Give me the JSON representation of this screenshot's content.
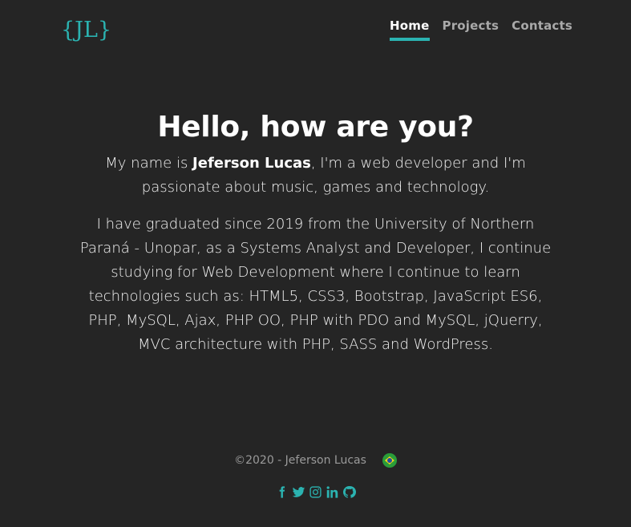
{
  "header": {
    "logo": "{JL}",
    "nav": [
      {
        "label": "Home",
        "active": true
      },
      {
        "label": "Projects",
        "active": false
      },
      {
        "label": "Contacts",
        "active": false
      }
    ]
  },
  "hero": {
    "title": "Hello, how are you?",
    "intro_before": "My name is ",
    "name": "Jeferson Lucas",
    "intro_after": ", I'm a web developer and I'm passionate about music, games and technology.",
    "about": "I have graduated since 2019 from the University of Northern Paraná - Unopar, as a Systems Analyst and Developer, I continue studying for Web Development where I continue to learn technologies such as: HTML5, CSS3, Bootstrap, JavaScript ES6, PHP, MySQL, Ajax, PHP OO, PHP with PDO and MySQL, jQuerry, MVC architecture with PHP, SASS and WordPress."
  },
  "footer": {
    "copyright": "©2020 - Jeferson Lucas",
    "language_icon": "brazil-flag-icon",
    "socials": [
      "facebook-icon",
      "twitter-icon",
      "instagram-icon",
      "linkedin-icon",
      "github-icon"
    ]
  },
  "colors": {
    "background": "#252525",
    "accent": "#2bb3b1",
    "nav_inactive": "#a9a9a9",
    "footer_text": "#9a9a9a"
  }
}
